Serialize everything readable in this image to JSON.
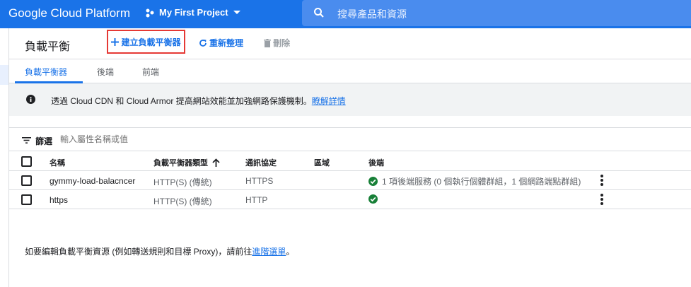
{
  "topbar": {
    "brand": "Google Cloud Platform",
    "project": "My First Project",
    "search_placeholder": "搜尋產品和資源"
  },
  "header": {
    "title": "負載平衡",
    "create_label": "建立負載平衡器",
    "refresh_label": "重新整理",
    "delete_label": "刪除"
  },
  "tabs": [
    {
      "label": "負載平衡器"
    },
    {
      "label": "後端"
    },
    {
      "label": "前端"
    }
  ],
  "banner": {
    "text": "透過 Cloud CDN 和 Cloud Armor 提高網站效能並加強網路保護機制。",
    "link": "瞭解詳情"
  },
  "filter": {
    "label": "篩選",
    "placeholder": "輸入屬性名稱或值"
  },
  "table": {
    "columns": [
      "名稱",
      "負載平衡器類型",
      "通訊協定",
      "區域",
      "後端"
    ],
    "rows": [
      {
        "name": "gymmy-load-balacncer",
        "type": "HTTP(S) (傳統)",
        "protocol": "HTTPS",
        "region": "",
        "backend": "1 項後端服務 (0 個執行個體群組，1 個網路端點群組)"
      },
      {
        "name": "https",
        "type": "HTTP(S) (傳統)",
        "protocol": "HTTP",
        "region": "",
        "backend": ""
      }
    ]
  },
  "footnote": {
    "text": "如要編輯負載平衡資源 (例如轉送規則和目標 Proxy)，請前往",
    "link": "進階選單",
    "end": "。"
  },
  "colors": {
    "accent": "#1a73e8",
    "highlight_border": "#e53935",
    "ok": "#188038"
  }
}
